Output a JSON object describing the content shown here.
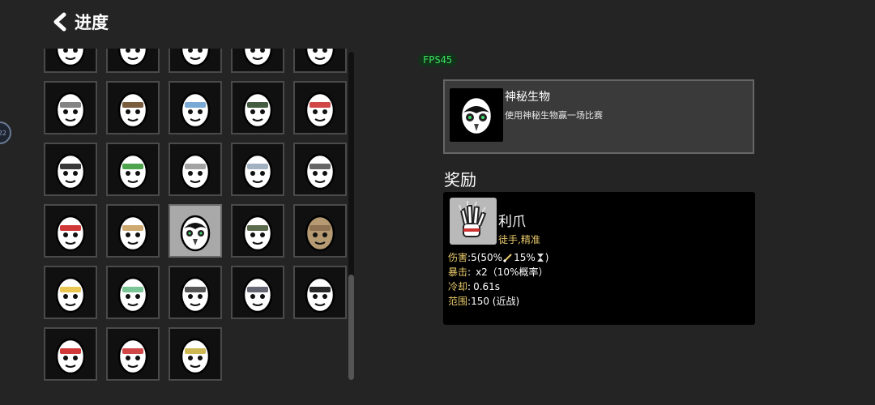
{
  "header": {
    "title": "进度"
  },
  "side_badge": "22",
  "fps_label": "FPS45",
  "grid": {
    "tiles": [
      {
        "icon": "egg-bandage-icon"
      },
      {
        "icon": "egg-mustache-icon"
      },
      {
        "icon": "egg-scarred-icon"
      },
      {
        "icon": "egg-orange-beak-icon"
      },
      {
        "icon": "egg-blue-suit-icon"
      },
      {
        "icon": "egg-knight-helmet-icon"
      },
      {
        "icon": "egg-bearded-hair-icon"
      },
      {
        "icon": "egg-glasses-mask-icon"
      },
      {
        "icon": "egg-ninja-icon"
      },
      {
        "icon": "egg-glasses-grin-icon"
      },
      {
        "icon": "egg-monocle-icon"
      },
      {
        "icon": "egg-money-glasses-icon"
      },
      {
        "icon": "egg-viking-icon"
      },
      {
        "icon": "egg-drool-icon"
      },
      {
        "icon": "egg-worried-icon"
      },
      {
        "icon": "egg-red-mask-icon"
      },
      {
        "icon": "egg-duck-icon"
      },
      {
        "icon": "egg-mystery-creature-icon",
        "selected": true
      },
      {
        "icon": "egg-safari-hat-icon"
      },
      {
        "icon": "egg-potato-icon"
      },
      {
        "icon": "egg-crown-icon"
      },
      {
        "icon": "egg-zombie-icon"
      },
      {
        "icon": "egg-plain-icon"
      },
      {
        "icon": "egg-ufo-icon"
      },
      {
        "icon": "egg-sunglasses-icon"
      },
      {
        "icon": "egg-angry-icon"
      },
      {
        "icon": "egg-red-nose-icon"
      },
      {
        "icon": "egg-devil-horns-icon"
      }
    ]
  },
  "achievement": {
    "name": "神秘生物",
    "description": "使用神秘生物赢一场比赛",
    "icon": "mystery-creature-icon"
  },
  "reward": {
    "section_title": "奖励",
    "name": "利爪",
    "tags": "徒手,精准",
    "icon": "claw-glove-icon",
    "stats": {
      "damage_label": "伤害",
      "damage_value_a": "5(50%",
      "damage_value_b": "15%",
      "damage_value_c": ")",
      "crit_label": "暴击",
      "crit_value": "x2（10%概率）",
      "cooldown_label": "冷却",
      "cooldown_value": "0.61s",
      "range_label": "范围",
      "range_value": "150 (近战)",
      "separator": ":"
    }
  },
  "colors": {
    "background": "#242424",
    "tag_gold": "#e8c96a",
    "fps_green": "#3ee060",
    "tile_selected": "#a9a9a9"
  }
}
